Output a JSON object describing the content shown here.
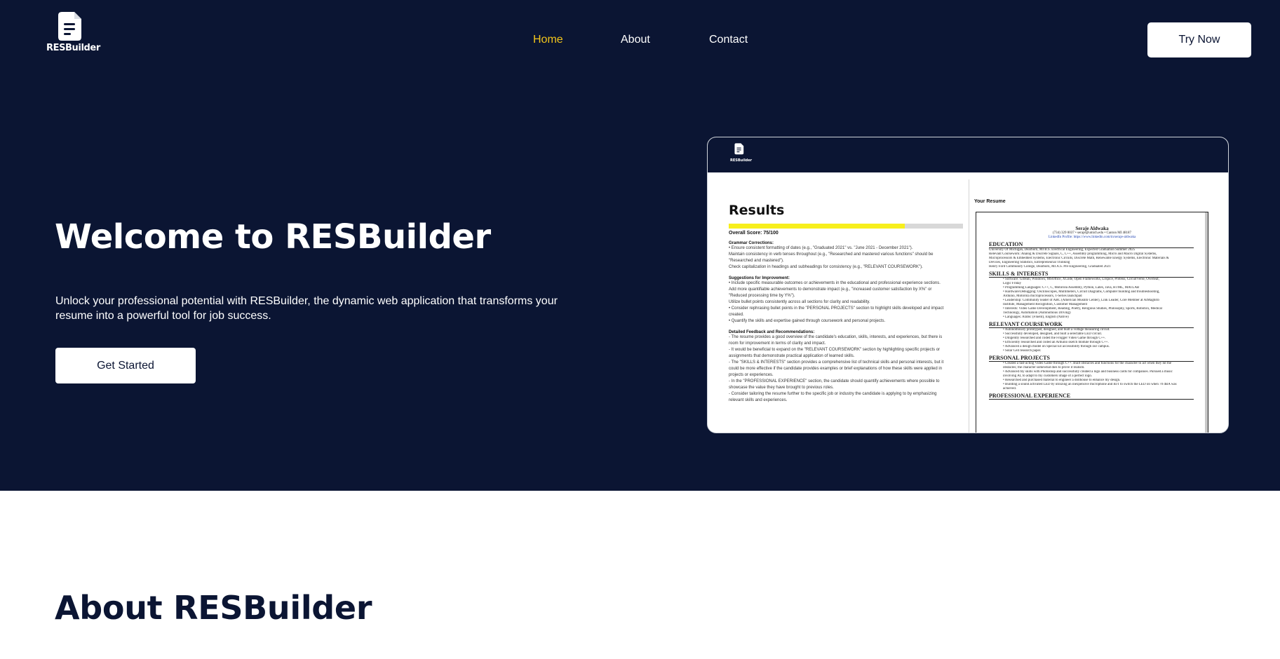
{
  "brand": {
    "logo_text": "RESBuilder",
    "icon": "document-icon"
  },
  "nav": {
    "items": [
      {
        "label": "Home",
        "active": true
      },
      {
        "label": "About",
        "active": false
      },
      {
        "label": "Contact",
        "active": false
      }
    ]
  },
  "header": {
    "cta_label": "Try Now"
  },
  "hero": {
    "title": "Welcome to RESBuilder",
    "description": "Unlock your professional potential with RESBuilder, the dynamic web application that transforms your resume into a powerful tool for job success.",
    "button_label": "Get Started"
  },
  "preview": {
    "logo_text": "RESBuilder",
    "results_title": "Results",
    "score_fraction": 0.75,
    "score_label": "Overall Score: 75/100",
    "grammar_heading": "Grammar Corrections:",
    "grammar_lines": [
      "• Ensure consistent formatting of dates (e.g., \"Graduated 2021\" vs. \"June 2021 - December 2021\").",
      "  Maintain consistency in verb tenses throughout (e.g., \"Researched and mastered various functions\" should be",
      "\"Researched and mastered\").",
      "  Check capitalization in headings and subheadings for consistency (e.g., \"RELEVANT COURSEWORK\")."
    ],
    "suggestions_heading": "Suggestions for Improvement:",
    "suggestion_lines": [
      "• Include specific measurable outcomes or achievements in the educational and professional experience sections.",
      "  Add more quantifiable achievements to demonstrate impact (e.g., \"increased customer satisfaction by X%\" or",
      "\"Reduced processing time by Y%\").",
      "  Utilize bullet points consistently across all sections for clarity and readability.",
      "• Consider rephrasing bullet points in the \"PERSONAL PROJECTS\" section to highlight skills developed and impact",
      "created.",
      "• Quantify the skills and expertise gained through coursework and personal projects."
    ],
    "detailed_heading": "Detailed Feedback and Recommendations:",
    "detailed_lines": [
      "- The resume provides a good overview of the candidate's education, skills, interests, and experiences, but there is",
      "room for improvement in terms of clarity and impact.",
      "- It would be beneficial to expand on the \"RELEVANT COURSEWORK\" section by highlighting specific projects or",
      "assignments that demonstrate practical application of learned skills.",
      "- The \"SKILLS & INTERESTS\" section provides a comprehensive list of technical skills and personal interests, but it",
      "could be more effective if the candidate provides examples or brief explanations of how these skills were applied in",
      "projects or experiences.",
      "- In the \"PROFESSIONAL EXPERIENCE\" section, the candidate should quantify achievements where possible to",
      "showcase the value they have brought to previous roles.",
      "- Consider tailoring the resume further to the specific job or industry the candidate is applying to by emphasizing",
      "relevant skills and experiences."
    ],
    "your_resume_label": "Your Resume",
    "resume": {
      "name": "Seraje Aldwaka",
      "contact": "(734) 329 0037 • seraje@umich.edu • Canton MI 48187",
      "linkedin": "LinkedIn Profile: https://www.linkedin.com/in/seraje-aldwaka",
      "sections": [
        {
          "title": "EDUCATION",
          "lines": [
            "University Of Michigan, Dearborn, MI          B.S. Electrical Engineering, Expected Graduation Summer 2025",
            "Relevant Coursework: Analog & Discrete Signals, C, C++, Assembly programming, Micro and Macro Digital Systems,",
            "Microprocessors & Embedded Systems, Electronic Circuits, Discrete Math, Renewable Energy Systems, Electronic Materials &",
            "Devices, Engineering Statistics, Entrepreneurial Thinking",
            "Henry Ford Community College, Dearborn, MI                 A.S. Pre-Engineering, Graduated 2021"
          ]
        },
        {
          "title": "SKILLS & INTERESTS",
          "lines": [
            "• Software: GitHub, Windows, MSOffice, XCode, Open Frameworks, LTspice, Proteus, CircuitVerse, Overleaf,",
            "  Logic Friday",
            "• Programming Languages: C++, C, Motorola Assembly, Python, Latex, Java, HTML, MATLAB",
            "• Hardware/Debugging: Oscilloscopes, Multimeters, Circuit Diagrams, Computer building and troubleshooting,",
            "  Arduino, Motorola microprocessors, T-Series launchpad",
            "• Leadership: Community leader of ABC (American Muslim Center), Link Leader, Core Member at AlMaghrib",
            "  Institute, Management Recognition, Customer Management",
            "• Interests: Video Game Development, Reading, Poetry, Religious Studies, Philosophy, Sports, Robotics, Medical",
            "  Technology, Automation (Autonomous Driving)",
            "• Languages: Arabic (Fluent), English (Native)"
          ]
        },
        {
          "title": "RELEVANT COURSEWORK",
          "lines": [
            "• Autonomously prototyped, designed, and built a voltage measuring circuit.",
            "• Successfully developed, designed, and built a selectable LED circuit.",
            "• Diligently researched and coded the Frogger Video Game through C++.",
            "• Efficiently researched and coded an Arduino sketch module through C++.",
            "• Advanced a design model on Special Ed accessibility through our campus.",
            "• Solar Cell research paper."
          ]
        },
        {
          "title": "PERSONAL PROJECTS",
          "lines": [
            "• Created a fast-acting Video Game through C++. Built obstacles and functions for the character to act when they hit the",
            "  obstacles; the character somewhat dies to prove it realism.",
            "• Advanced my skills with Photoshop and successfully created a logo and business cards for companies. Pursued a music",
            "  involving AI, to adapt to my customers image of a perfect logo.",
            "• Researched and purchased material to engineer a dollhouse to enhance my design.",
            "• Building a sound activated LED by utilizing an inexpensive microphone and BJT to switch the LED on when 70 dBA was",
            "  achieved."
          ]
        },
        {
          "title": "PROFESSIONAL EXPERIENCE",
          "lines": []
        }
      ]
    }
  },
  "about": {
    "title": "About RESBuilder"
  }
}
